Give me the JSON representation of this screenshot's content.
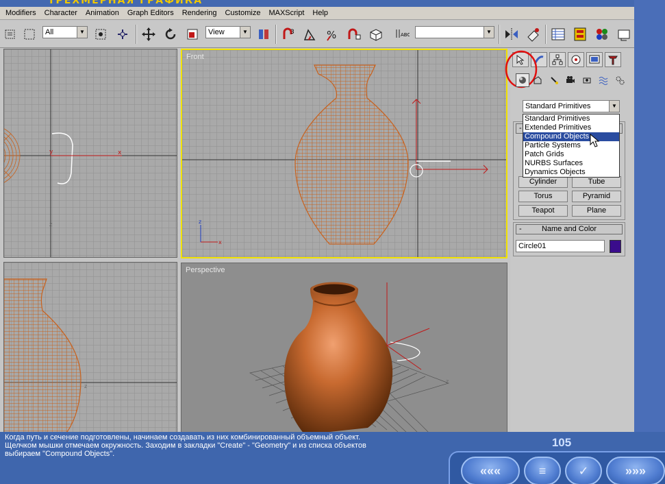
{
  "window": {
    "title": "ТРЕХМЕРНАЯ ГРАФИКА"
  },
  "menu": [
    "Modifiers",
    "Character",
    "Animation",
    "Graph Editors",
    "Rendering",
    "Customize",
    "MAXScript",
    "Help"
  ],
  "toolbar": {
    "filter_value": "All",
    "coord_value": "View",
    "named_selection_value": ""
  },
  "viewports": {
    "top_label": "",
    "front_label": "Front",
    "left_label": "",
    "perspective_label": "Perspective"
  },
  "command_panel": {
    "category_value": "Standard Primitives",
    "category_options": [
      "Standard Primitives",
      "Extended Primitives",
      "Compound Objects",
      "Particle Systems",
      "Patch Grids",
      "NURBS Surfaces",
      "Dynamics Objects"
    ],
    "selected_option": "Compound Objects",
    "object_buttons": [
      "Cylinder",
      "Tube",
      "Torus",
      "Pyramid",
      "Teapot",
      "Plane"
    ],
    "name_color_title": "Name and Color",
    "rollout_minus": "-",
    "object_name": "Circle01",
    "object_color": "#3a0c8c"
  },
  "lesson": {
    "lines": [
      "Когда путь и сечение подготовлены, начинаем создавать из них комбинированный объемный объект.",
      "Щелчком мышки отмечаем окружность. Заходим в закладки \"Create\" - \"Geometry\" и из списка объектов",
      "выбираем \"Compound Objects\"."
    ],
    "page_number": "105"
  },
  "nav": {
    "prev": "«««",
    "menu": "≡",
    "check": "✓",
    "next": "»»»"
  }
}
